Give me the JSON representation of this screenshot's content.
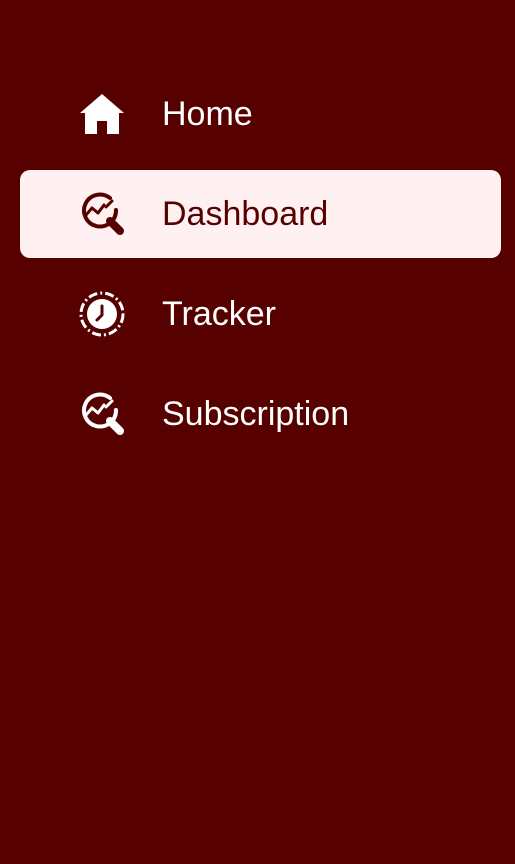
{
  "sidebar": {
    "items": [
      {
        "label": "Home",
        "icon": "home-icon",
        "active": false
      },
      {
        "label": "Dashboard",
        "icon": "chart-magnifier-icon",
        "active": true
      },
      {
        "label": "Tracker",
        "icon": "clock-icon",
        "active": false
      },
      {
        "label": "Subscription",
        "icon": "chart-magnifier-icon",
        "active": false
      }
    ]
  },
  "colors": {
    "background": "#560000",
    "active_background": "#fff1f1",
    "text": "#ffffff",
    "active_text": "#560000"
  }
}
